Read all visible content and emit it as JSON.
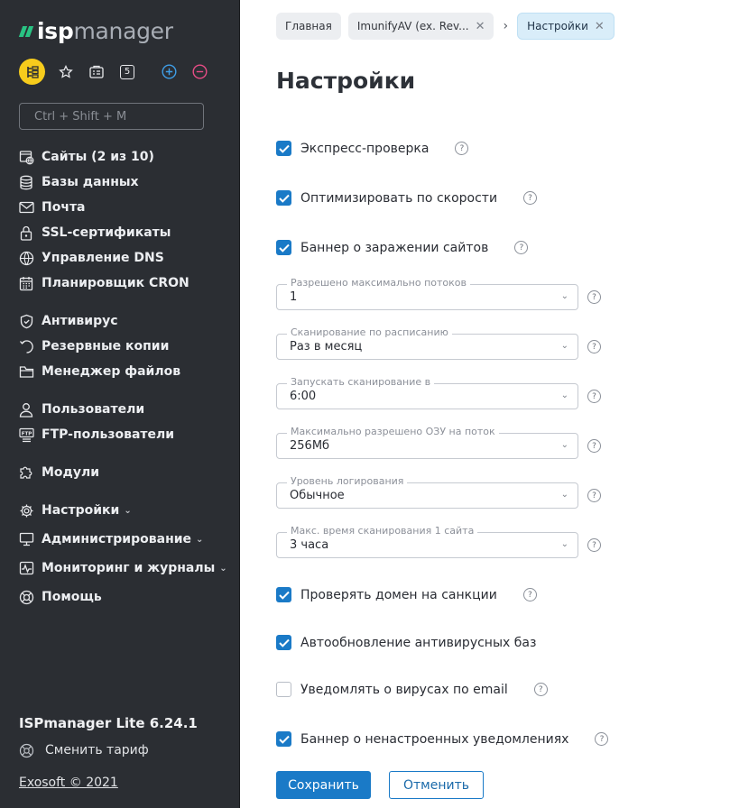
{
  "brand": {
    "logo_bold": "isp",
    "logo_light": "manager",
    "accent": "#29c383"
  },
  "quickbar": {
    "badge": "5"
  },
  "search": {
    "placeholder": "Ctrl + Shift + M"
  },
  "menu": [
    {
      "label": "Сайты (2 из 10)",
      "icon": "globe-page-icon"
    },
    {
      "label": "Базы данных",
      "icon": "database-icon"
    },
    {
      "label": "Почта",
      "icon": "mail-icon"
    },
    {
      "label": "SSL-сертификаты",
      "icon": "lock-icon"
    },
    {
      "label": "Управление DNS",
      "icon": "globe-icon"
    },
    {
      "label": "Планировщик CRON",
      "icon": "calendar-icon"
    },
    {
      "label": "Антивирус",
      "icon": "shield-icon"
    },
    {
      "label": "Резервные копии",
      "icon": "backup-icon"
    },
    {
      "label": "Менеджер файлов",
      "icon": "folder-icon"
    },
    {
      "label": "Пользователи",
      "icon": "user-icon"
    },
    {
      "label": "FTP-пользователи",
      "icon": "ftp-icon"
    },
    {
      "label": "Модули",
      "icon": "puzzle-icon"
    },
    {
      "label": "Настройки",
      "icon": "gear-icon"
    },
    {
      "label": "Администрирование",
      "icon": "monitor-icon"
    },
    {
      "label": "Мониторинг и журналы",
      "icon": "pulse-icon"
    },
    {
      "label": "Помощь",
      "icon": "lifebuoy-icon"
    }
  ],
  "footer": {
    "version": "ISPmanager Lite 6.24.1",
    "tariff": "Сменить тариф",
    "copyright": "Exosoft © 2021"
  },
  "breadcrumbs": [
    "Главная",
    "ImunifyAV (ex. Rev...",
    "Настройки"
  ],
  "page": {
    "title": "Настройки",
    "checks": [
      {
        "label": "Экспресс-проверка",
        "checked": true
      },
      {
        "label": "Оптимизировать по скорости",
        "checked": true
      },
      {
        "label": "Баннер о заражении сайтов",
        "checked": true
      }
    ],
    "selects": [
      {
        "label": "Разрешено максимально потоков",
        "value": "1"
      },
      {
        "label": "Сканирование по расписанию",
        "value": "Раз в месяц"
      },
      {
        "label": "Запускать сканирование в",
        "value": "6:00"
      },
      {
        "label": "Максимально разрешено ОЗУ на поток",
        "value": "256Мб"
      },
      {
        "label": "Уровень логирования",
        "value": "Обычное"
      },
      {
        "label": "Макс. время сканирования 1 сайта",
        "value": "3 часа"
      }
    ],
    "checks2": [
      {
        "label": "Проверять домен на санкции",
        "checked": true
      },
      {
        "label": "Автообновление антивирусных баз",
        "checked": true
      },
      {
        "label": "Уведомлять о вирусах по email",
        "checked": false
      },
      {
        "label": "Баннер о ненастроенных уведомлениях",
        "checked": true
      }
    ],
    "help_glyph": "?",
    "save": "Сохранить",
    "cancel": "Отменить"
  }
}
